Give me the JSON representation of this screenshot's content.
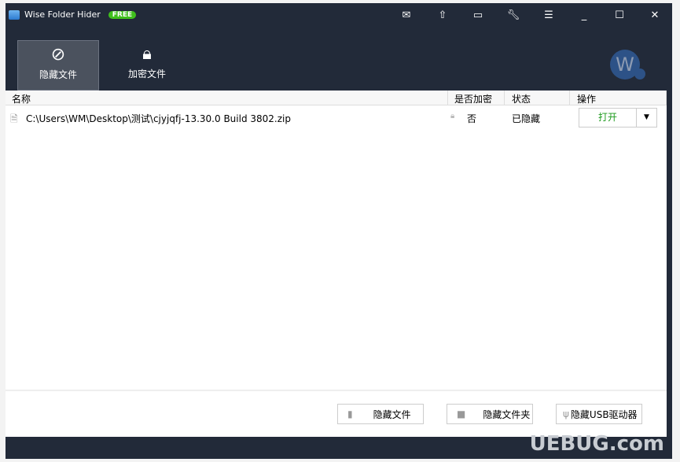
{
  "app": {
    "title": "Wise Folder Hider",
    "badge": "FREE"
  },
  "toolbar_icons": [
    "mail-icon",
    "upgrade-icon",
    "feedback-icon",
    "settings-icon",
    "menu-icon",
    "minimize-icon",
    "maximize-icon",
    "close-icon"
  ],
  "tabs": [
    {
      "label": "隐藏文件",
      "icon": "hidden-eye-icon",
      "active": true
    },
    {
      "label": "加密文件",
      "icon": "lock-pro-icon",
      "active": false
    }
  ],
  "avatar": "W",
  "table": {
    "headers": [
      "名称",
      "是否加密",
      "状态",
      "操作"
    ],
    "rows": [
      {
        "name": "C:\\Users\\WM\\Desktop\\测试\\cjyjqfj-13.30.0 Build 3802.zip",
        "encrypted": "否",
        "status": "已隐藏",
        "action": "打开"
      }
    ]
  },
  "buttons": {
    "hide_file": "隐藏文件",
    "hide_folder": "隐藏文件夹",
    "hide_usb": "隐藏USB驱动器"
  },
  "watermark": "UEBUG.com",
  "colors": {
    "frame": "#222a39",
    "open": "#1e9b1e",
    "badge": "#3fbf1c"
  }
}
